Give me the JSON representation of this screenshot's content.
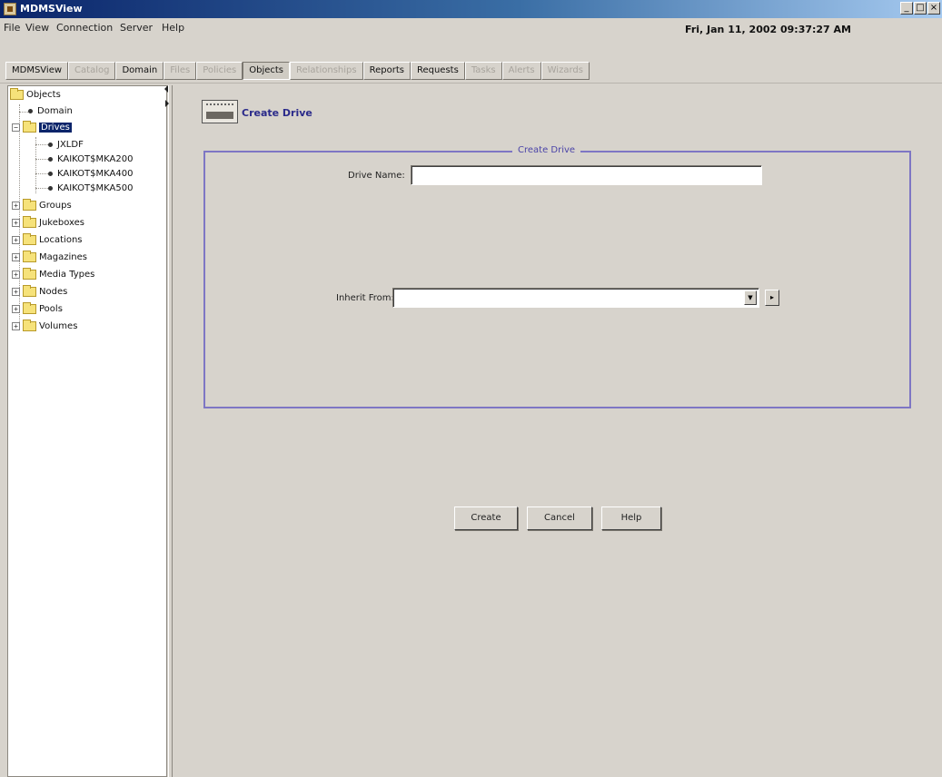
{
  "window": {
    "title": "MDMSView",
    "minimize": "_",
    "maximize": "□",
    "close": "×"
  },
  "menu": {
    "items": [
      "File",
      "View",
      "Connection",
      "Server",
      "Help"
    ],
    "datetime": "Fri, Jan 11, 2002 09:37:27 AM"
  },
  "tabs": [
    {
      "label": "MDMSView",
      "state": "normal"
    },
    {
      "label": "Catalog",
      "state": "disabled"
    },
    {
      "label": "Domain",
      "state": "normal"
    },
    {
      "label": "Files",
      "state": "disabled"
    },
    {
      "label": "Policies",
      "state": "disabled"
    },
    {
      "label": "Objects",
      "state": "active"
    },
    {
      "label": "Relationships",
      "state": "disabled"
    },
    {
      "label": "Reports",
      "state": "normal"
    },
    {
      "label": "Requests",
      "state": "normal"
    },
    {
      "label": "Tasks",
      "state": "disabled"
    },
    {
      "label": "Alerts",
      "state": "disabled"
    },
    {
      "label": "Wizards",
      "state": "disabled"
    }
  ],
  "tree": {
    "root": "Objects",
    "domain": "Domain",
    "drives_label": "Drives",
    "drives_children": [
      "JXLDF",
      "KAIKOT$MKA200",
      "KAIKOT$MKA400",
      "KAIKOT$MKA500"
    ],
    "folders": [
      "Groups",
      "Jukeboxes",
      "Locations",
      "Magazines",
      "Media Types",
      "Nodes",
      "Pools",
      "Volumes"
    ]
  },
  "content": {
    "header_title": "Create Drive",
    "group_title": "Create Drive",
    "drive_name_label": "Drive Name:",
    "drive_name_value": "",
    "inherit_from_label": "Inherit From:",
    "inherit_from_value": ""
  },
  "buttons": {
    "create": "Create",
    "cancel": "Cancel",
    "help": "Help"
  }
}
